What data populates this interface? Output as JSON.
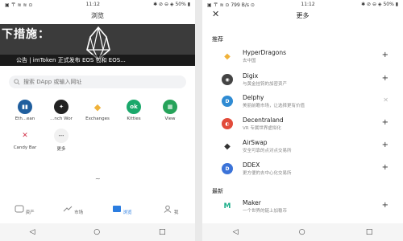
{
  "left": {
    "status": {
      "left": "▣ 〒 ≋ ≋ ⊙",
      "center": "11:12",
      "right": "✱ ⊘ ⊖ ◈ 50% ▮"
    },
    "title": "浏览",
    "banner": {
      "slogan": "下措施：",
      "caption": "公告 | imToken 正式发布 EOS 包和 EOS..."
    },
    "search": {
      "placeholder": "搜索 DApp 或输入网址"
    },
    "apps": [
      {
        "label": "Eth...ean",
        "color": "#1f5e9e",
        "glyph": "▮▮"
      },
      {
        "label": "...nch Wor",
        "color": "#222222",
        "glyph": "✦"
      },
      {
        "label": "Exchanges",
        "color": "#f0b23a",
        "glyph": "◆"
      },
      {
        "label": "Kitties",
        "color": "#1aa86b",
        "glyph": "ok"
      },
      {
        "label": "View",
        "color": "#26a35a",
        "glyph": "▦"
      },
      {
        "label": "Candy Bar",
        "color": "#ffffff",
        "glyph": "✕"
      },
      {
        "label": "更多",
        "color": "#f1f1f1",
        "glyph": "⋯"
      }
    ],
    "tilde": "~",
    "nav": [
      {
        "label": "资产",
        "icon": "wallet-icon"
      },
      {
        "label": "市场",
        "icon": "market-icon"
      },
      {
        "label": "浏览",
        "icon": "browser-icon"
      },
      {
        "label": "我",
        "icon": "profile-icon"
      }
    ],
    "sysnav": [
      "◁",
      "○",
      "□"
    ]
  },
  "right": {
    "status": {
      "left": "▣ 〒 ≋ ⊙ 799 B/s ⊙",
      "center": "11:12",
      "right": "✱ ⊘ ⊖ ◈ 50% ▮"
    },
    "title": "更多",
    "close": "✕",
    "sections": {
      "recommended": "推荐",
      "latest": "最新"
    },
    "dapps": [
      {
        "name": "HyperDragons",
        "desc": "去中国",
        "action": "+",
        "color": "#f0b23a",
        "glyph": "◆"
      },
      {
        "name": "Digix",
        "desc": "与黄金挂钩的加密资产",
        "action": "+",
        "color": "#444444",
        "glyph": "◉"
      },
      {
        "name": "Delphy",
        "desc": "美丽前瞻市场，让选择更有价值",
        "action": "✕",
        "color": "#2f8bd3",
        "glyph": "D"
      },
      {
        "name": "Decentraland",
        "desc": "VR 专属世界虚拟化",
        "action": "+",
        "color": "#e24b3a",
        "glyph": "◐"
      },
      {
        "name": "AirSwap",
        "desc": "安全可靠的点对点交易所",
        "action": "+",
        "color": "#333333",
        "glyph": "◆"
      },
      {
        "name": "DDEX",
        "desc": "更方便的去中心化交易所",
        "action": "+",
        "color": "#3b73d8",
        "glyph": "D"
      },
      {
        "name": "Maker",
        "desc": "一个世界的链上加稳币",
        "action": "+",
        "color": "#1cae8a",
        "glyph": "M"
      }
    ],
    "sysnav": [
      "◁",
      "○",
      "□"
    ]
  }
}
